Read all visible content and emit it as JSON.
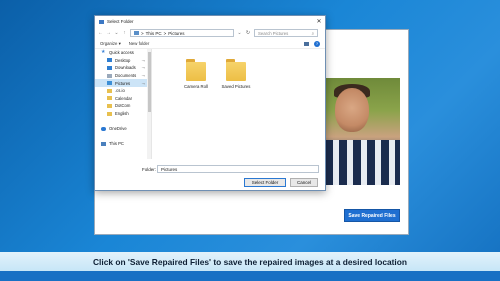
{
  "dialog": {
    "title": "Select Folder",
    "close_glyph": "✕",
    "address": [
      "This PC",
      "Pictures"
    ],
    "address_sep": ">",
    "search_placeholder": "Search Pictures",
    "toolbar": {
      "organize": "Organize ▾",
      "new_folder": "New folder"
    },
    "sidebar": [
      {
        "label": "Quick access",
        "icon": "star-icon",
        "level": 0,
        "pin": false
      },
      {
        "label": "Desktop",
        "icon": "desktop-icon",
        "level": 1,
        "pin": true
      },
      {
        "label": "Downloads",
        "icon": "download-icon",
        "level": 1,
        "pin": true
      },
      {
        "label": "Documents",
        "icon": "documents-icon",
        "level": 1,
        "pin": true
      },
      {
        "label": "Pictures",
        "icon": "pictures-icon",
        "level": 1,
        "pin": true,
        "selected": true
      },
      {
        "label": ".cs.io",
        "icon": "folder-icon",
        "level": 1,
        "pin": false
      },
      {
        "label": "Calendar",
        "icon": "folder-icon",
        "level": 1,
        "pin": false
      },
      {
        "label": "DotCom",
        "icon": "folder-icon",
        "level": 1,
        "pin": false
      },
      {
        "label": "English",
        "icon": "folder-icon",
        "level": 1,
        "pin": false
      },
      {
        "label": "",
        "icon": "",
        "level": 0,
        "pin": false
      },
      {
        "label": "OneDrive",
        "icon": "onedrive-icon",
        "level": 0,
        "pin": false
      },
      {
        "label": "",
        "icon": "",
        "level": 0,
        "pin": false
      },
      {
        "label": "This PC",
        "icon": "this-pc-icon",
        "level": 0,
        "pin": false
      }
    ],
    "folders": [
      "Camera Roll",
      "Saved Pictures"
    ],
    "folder_label": "Folder:",
    "folder_value": "Pictures",
    "select_button": "Select Folder",
    "cancel_button": "Cancel"
  },
  "app": {
    "save_button": "Save Repaired Files"
  },
  "caption": "Click on 'Save Repaired Files' to save the repaired images at a desired location"
}
